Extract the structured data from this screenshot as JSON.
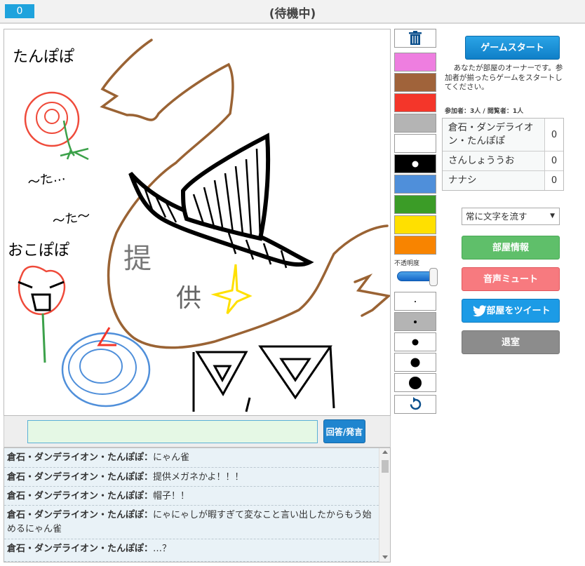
{
  "header": {
    "score": "0",
    "status": "(待機中)"
  },
  "canvas": {
    "texts": [
      "たんぽぽ",
      "〜た…",
      "〜た〜",
      "おこぽぽ",
      "提",
      "供"
    ]
  },
  "palette": {
    "colors": [
      "#ee7ee0",
      "#a0633a",
      "#f4362a",
      "#b4b4b4",
      "#ffffff",
      "#000000",
      "#4f8fda",
      "#3b9c27",
      "#ffe000",
      "#f88400"
    ],
    "opacity_label": "不透明度",
    "opacity_value": 1.0
  },
  "right": {
    "start_label": "ゲームスタート",
    "owner_note": "あなたが部屋のオーナーです。参加者が揃ったらゲームをスタートしてください。",
    "counts": "参加者：3人 / 閲覧者：1人",
    "players": [
      {
        "name": "倉石・ダンデライオン・たんぽぽ",
        "score": "0"
      },
      {
        "name": "さんしょううお",
        "score": "0"
      },
      {
        "name": "ナナシ",
        "score": "0"
      }
    ],
    "select_value": "常に文字を流す",
    "info_label": "部屋情報",
    "mute_label": "音声ミュート",
    "tweet_label": "部屋をツイート",
    "leave_label": "退室"
  },
  "answer": {
    "value": "",
    "button_label": "回答/発言"
  },
  "chat": [
    {
      "who": "倉石・ダンデライオン・たんぽぽ：",
      "msg": "にゃん雀"
    },
    {
      "who": "倉石・ダンデライオン・たんぽぽ：",
      "msg": "提供メガネかよ！！！"
    },
    {
      "who": "倉石・ダンデライオン・たんぽぽ：",
      "msg": "帽子！！"
    },
    {
      "who": "倉石・ダンデライオン・たんぽぽ：",
      "msg": "にゃにゃしが暇すぎて変なこと言い出したからもう始めるにゃん雀"
    },
    {
      "who": "倉石・ダンデライオン・たんぽぽ：",
      "msg": "…？"
    }
  ]
}
